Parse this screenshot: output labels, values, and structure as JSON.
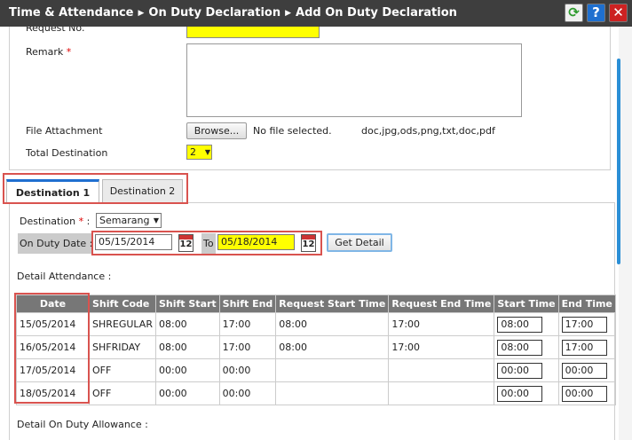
{
  "header": {
    "crumbs": [
      "Time & Attendance",
      "On Duty Declaration",
      "Add On Duty Declaration"
    ],
    "refresh_icon": "refresh-icon",
    "help_label": "?",
    "close_label": "✕"
  },
  "form": {
    "request_no_label": "Request No.",
    "remark_label": "Remark",
    "required_mark": "*",
    "file_attachment_label": "File Attachment",
    "browse_label": "Browse...",
    "no_file_text": "No file selected.",
    "allowed_exts": "doc,jpg,ods,png,txt,doc,pdf",
    "total_destination_label": "Total Destination",
    "total_destination_value": "2"
  },
  "tabs": [
    {
      "label": "Destination 1",
      "active": true
    },
    {
      "label": "Destination 2",
      "active": false
    }
  ],
  "destination": {
    "label": "Destination",
    "required_mark": "*",
    "colon": ":",
    "value": "Semarang",
    "on_duty_date_label": "On Duty Date",
    "from_date": "05/15/2014",
    "to_label": "To",
    "to_date": "05/18/2014",
    "calendar_text": "12",
    "get_detail_label": "Get Detail"
  },
  "detail_attendance_label": "Detail Attendance :",
  "table": {
    "headers": [
      "Date",
      "Shift Code",
      "Shift Start",
      "Shift End",
      "Request Start Time",
      "Request End Time",
      "Start Time",
      "End Time"
    ],
    "rows": [
      {
        "date": "15/05/2014",
        "shift_code": "SHREGULAR",
        "shift_start": "08:00",
        "shift_end": "17:00",
        "req_start": "08:00",
        "req_end": "17:00",
        "start": "08:00",
        "end": "17:00"
      },
      {
        "date": "16/05/2014",
        "shift_code": "SHFRIDAY",
        "shift_start": "08:00",
        "shift_end": "17:00",
        "req_start": "08:00",
        "req_end": "17:00",
        "start": "08:00",
        "end": "17:00"
      },
      {
        "date": "17/05/2014",
        "shift_code": "OFF",
        "shift_start": "00:00",
        "shift_end": "00:00",
        "req_start": "",
        "req_end": "",
        "start": "00:00",
        "end": "00:00"
      },
      {
        "date": "18/05/2014",
        "shift_code": "OFF",
        "shift_start": "00:00",
        "shift_end": "00:00",
        "req_start": "",
        "req_end": "",
        "start": "00:00",
        "end": "00:00"
      }
    ]
  },
  "detail_allowance_label": "Detail On Duty Allowance :",
  "colors": {
    "header_bg": "#3e3e3e",
    "highlight_yellow": "#ffff00",
    "annotation_red": "#d9534f",
    "tab_accent": "#1f6fd0"
  }
}
